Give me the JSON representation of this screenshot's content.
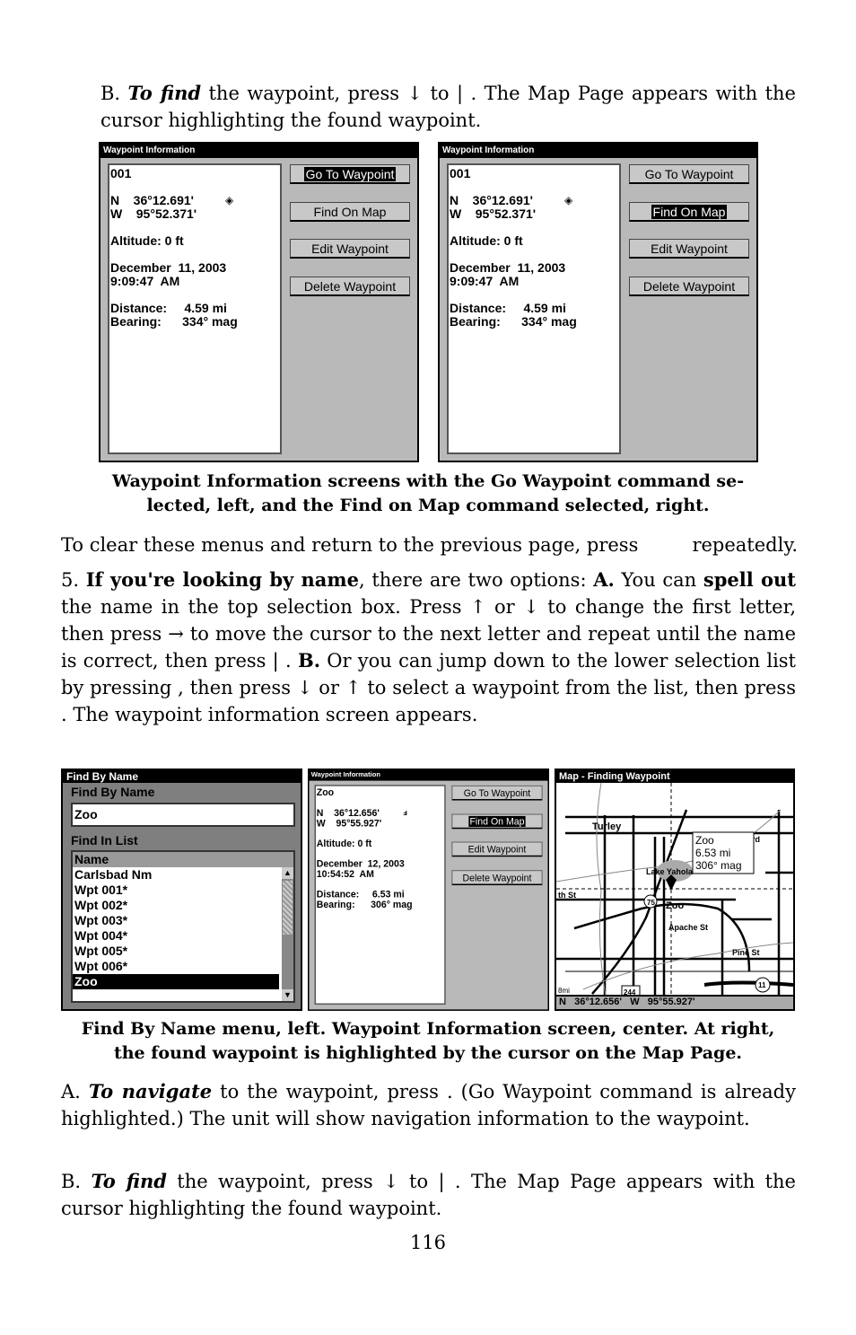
{
  "top_paragraph": [
    {
      "t": "B. "
    },
    {
      "t": "To find",
      "b": true,
      "i": true
    },
    {
      "t": " the waypoint, press ↓ to "
    },
    {
      "t": "              |       "
    },
    {
      "t": ". The Map Page appears with the cursor highlighting the found waypoint."
    }
  ],
  "top_screens": [
    {
      "title": "Waypoint Information",
      "name": "001",
      "lat": "N    36°12.691'",
      "lon": "W    95°52.371'",
      "altitude": "Altitude: 0 ft",
      "date": "December  11, 2003",
      "time": "9:09:47  AM",
      "distance": "Distance:     4.59 mi",
      "bearing": "Bearing:      334° mag",
      "icon": "diamond-waypoint-icon",
      "buttons": [
        {
          "label": "Go To Waypoint",
          "selected": true
        },
        {
          "label": "Find On Map",
          "selected": false
        },
        {
          "label": "Edit Waypoint",
          "selected": false
        },
        {
          "label": "Delete Waypoint",
          "selected": false
        }
      ]
    },
    {
      "title": "Waypoint Information",
      "name": "001",
      "lat": "N    36°12.691'",
      "lon": "W    95°52.371'",
      "altitude": "Altitude: 0 ft",
      "date": "December  11, 2003",
      "time": "9:09:47  AM",
      "distance": "Distance:     4.59 mi",
      "bearing": "Bearing:      334° mag",
      "icon": "diamond-waypoint-icon",
      "buttons": [
        {
          "label": "Go To Waypoint",
          "selected": false
        },
        {
          "label": "Find On Map",
          "selected": true
        },
        {
          "label": "Edit Waypoint",
          "selected": false
        },
        {
          "label": "Delete Waypoint",
          "selected": false
        }
      ]
    }
  ],
  "caption1": [
    "Waypoint Information screens with the Go Waypoint command se-",
    "lected, left, and the Find on Map command selected, right."
  ],
  "clear_paragraph": [
    {
      "t": "To clear these menus and return to the previous page, press         repeatedly."
    }
  ],
  "step5_paragraph": [
    {
      "t": "5. "
    },
    {
      "t": "If you're looking by name",
      "b": true
    },
    {
      "t": ", there are two options: "
    },
    {
      "t": "A.",
      "b": true
    },
    {
      "t": " You can "
    },
    {
      "t": "spell out",
      "b": true
    },
    {
      "t": " the name in the top selection box. Press ↑ or ↓ to change the first letter, then press → to move the cursor to the next letter and repeat until the name is correct, then press        |       . "
    },
    {
      "t": "B.",
      "b": true
    },
    {
      "t": " Or you can jump down to the lower selection list by pressing       , then press ↓ or ↑ to select a waypoint from the list, then press       . The waypoint information screen appears."
    }
  ],
  "find_by_name": {
    "title": "Find By Name",
    "section1": "Find By Name",
    "input_value": "Zoo",
    "section2": "Find In List",
    "column_header": "Name",
    "items": [
      "Carlsbad Nm",
      "Wpt 001*",
      "Wpt 002*",
      "Wpt 003*",
      "Wpt 004*",
      "Wpt 005*",
      "Wpt 006*",
      "Zoo"
    ],
    "selected": "Zoo"
  },
  "center_screen": {
    "title": "Waypoint Information",
    "name": "Zoo",
    "lat": "N    36°12.656'",
    "lon": "W    95°55.927'",
    "altitude": "Altitude: 0 ft",
    "date": "December  12, 2003",
    "time": "10:54:52  AM",
    "distance": "Distance:     6.53 mi",
    "bearing": "Bearing:      306° mag",
    "icon": "deer-zoo-icon",
    "buttons": [
      {
        "label": "Go To Waypoint",
        "selected": false
      },
      {
        "label": "Find On Map",
        "selected": true
      },
      {
        "label": "Edit Waypoint",
        "selected": false
      },
      {
        "label": "Delete Waypoint",
        "selected": false
      }
    ]
  },
  "map": {
    "title": "Map - Finding Waypoint",
    "labels": {
      "turley": "Turley",
      "lake": "Lake Yahola",
      "th_st": "th St",
      "zoo": "Zoo",
      "apache": "Apache St",
      "pine": "Pine St",
      "rd": "rd",
      "hwy75": "75",
      "hwy244": "244",
      "hwy11": "11",
      "scale": "8mi"
    },
    "popup": [
      "Zoo",
      "6.53 mi",
      "306° mag"
    ],
    "status_lat": "N   36°12.656'",
    "status_lon": "W   95°55.927'"
  },
  "caption2": [
    "Find By Name menu, left. Waypoint Information screen, center. At right,",
    "the found waypoint is highlighted by the cursor on the Map Page."
  ],
  "a_paragraph": [
    {
      "t": "A. "
    },
    {
      "t": "To navigate",
      "b": true,
      "i": true
    },
    {
      "t": " to the waypoint, press       . (Go Waypoint command is already highlighted.) The unit will show navigation information to the waypoint."
    }
  ],
  "b_paragraph": [
    {
      "t": "B. "
    },
    {
      "t": "To find",
      "b": true,
      "i": true
    },
    {
      "t": " the waypoint, press ↓ to               |       . The Map Page appears with the cursor highlighting the found waypoint."
    }
  ],
  "page_number": "116"
}
